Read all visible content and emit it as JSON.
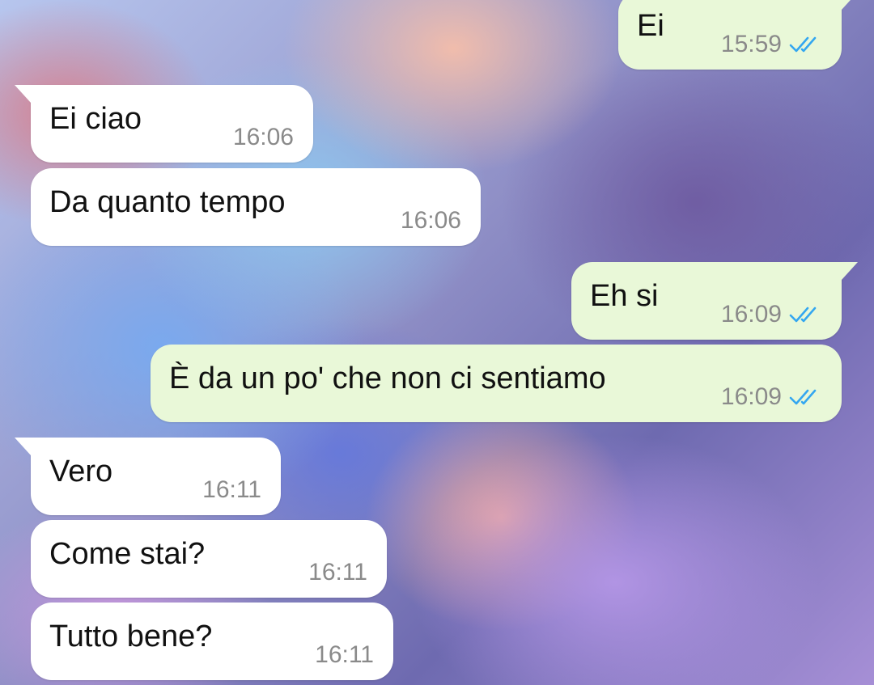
{
  "colors": {
    "incoming_bubble": "#ffffff",
    "outgoing_bubble": "#e9f8d8",
    "read_ticks": "#34a7f0",
    "timestamp": "#8a8a8a"
  },
  "messages": [
    {
      "direction": "outgoing",
      "text": "Ei",
      "time": "15:59",
      "status_icon": "double-check-icon"
    },
    {
      "direction": "incoming",
      "text": "Ei ciao",
      "time": "16:06"
    },
    {
      "direction": "incoming",
      "text": "Da quanto tempo",
      "time": "16:06"
    },
    {
      "direction": "outgoing",
      "text": "Eh si",
      "time": "16:09",
      "status_icon": "double-check-icon"
    },
    {
      "direction": "outgoing",
      "text": "È da un po' che non ci sentiamo",
      "time": "16:09",
      "status_icon": "double-check-icon"
    },
    {
      "direction": "incoming",
      "text": "Vero",
      "time": "16:11"
    },
    {
      "direction": "incoming",
      "text": "Come stai?",
      "time": "16:11"
    },
    {
      "direction": "incoming",
      "text": "Tutto bene?",
      "time": "16:11"
    }
  ]
}
